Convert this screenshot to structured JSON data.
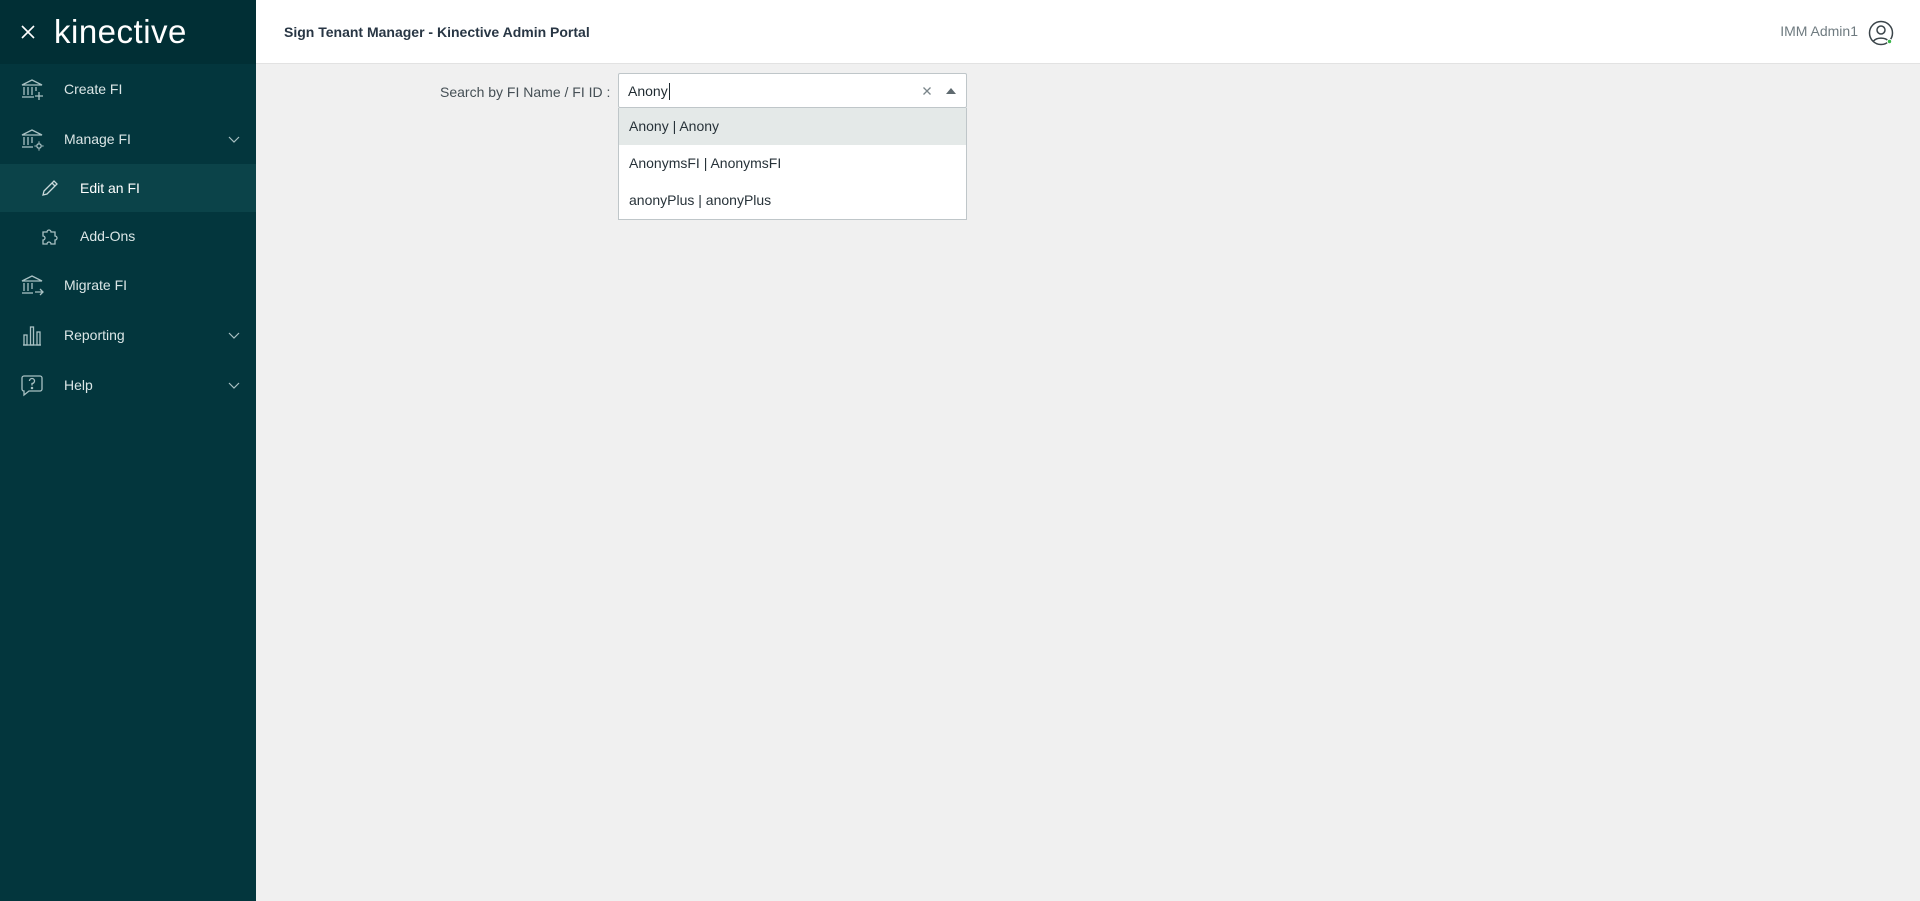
{
  "sidebar": {
    "logo": "kinective",
    "items": [
      {
        "label": "Create FI"
      },
      {
        "label": "Manage FI"
      },
      {
        "label": "Edit an FI"
      },
      {
        "label": "Add-Ons"
      },
      {
        "label": "Migrate FI"
      },
      {
        "label": "Reporting"
      },
      {
        "label": "Help"
      }
    ]
  },
  "header": {
    "title": "Sign Tenant Manager - Kinective Admin Portal",
    "user": "IMM Admin1"
  },
  "search": {
    "label": "Search by FI Name / FI ID :",
    "value": "Anony",
    "options": [
      {
        "label": "Anony | Anony"
      },
      {
        "label": "AnonymsFI | AnonymsFI"
      },
      {
        "label": "anonyPlus | anonyPlus"
      }
    ]
  },
  "colors": {
    "sidebar": "#03363d",
    "sidebar_active": "#0b4349",
    "online": "#3bb54a"
  }
}
